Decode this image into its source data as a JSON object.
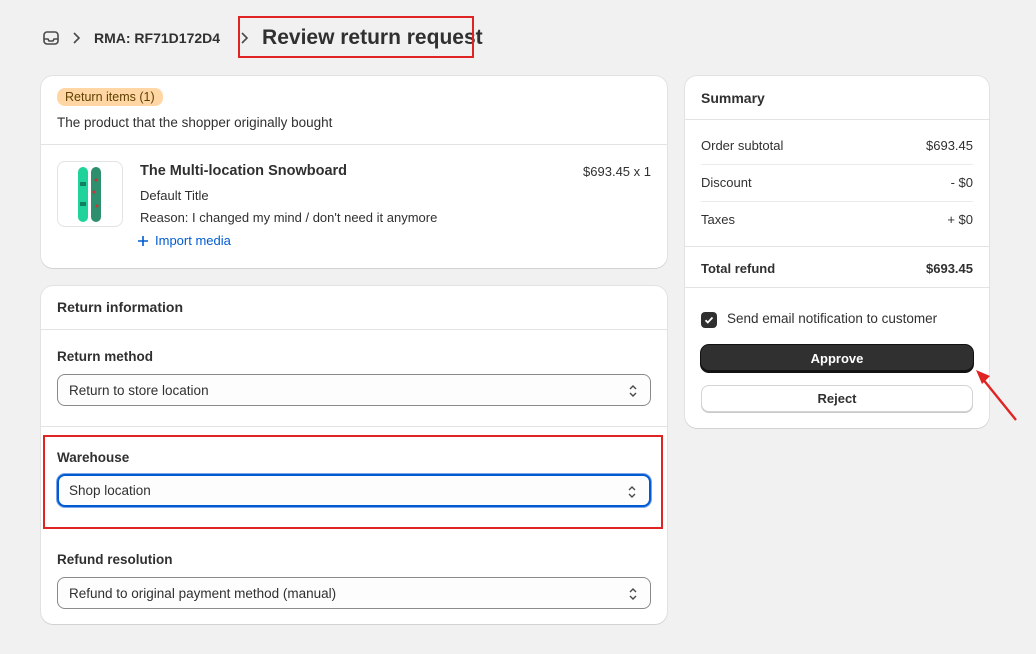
{
  "breadcrumb": {
    "icon": "inbox-icon",
    "rma": "RMA: RF71D172D4",
    "title": "Review return request"
  },
  "return_items": {
    "badge": "Return items (1)",
    "subtitle": "The product that the shopper originally bought",
    "items": [
      {
        "name": "The Multi-location Snowboard",
        "variant": "Default Title",
        "reason": "Reason: I changed my mind / don't need it anymore",
        "import_media": "Import media",
        "price_qty": "$693.45 x 1"
      }
    ]
  },
  "return_info": {
    "title": "Return information",
    "return_method": {
      "label": "Return to store location",
      "field_label": "Return method"
    },
    "warehouse": {
      "field_label": "Warehouse",
      "value": "Shop location"
    },
    "refund_resolution": {
      "field_label": "Refund resolution",
      "value": "Refund to original payment method (manual)"
    }
  },
  "summary": {
    "title": "Summary",
    "rows": [
      {
        "label": "Order subtotal",
        "value": "$693.45"
      },
      {
        "label": "Discount",
        "value": "- $0"
      },
      {
        "label": "Taxes",
        "value": "+ $0"
      }
    ],
    "total": {
      "label": "Total refund",
      "value": "$693.45"
    },
    "notify_label": "Send email notification to customer",
    "notify_checked": true,
    "approve_label": "Approve",
    "reject_label": "Reject"
  },
  "colors": {
    "badge_bg": "#ffd6a4",
    "link": "#005bd3",
    "focus": "#005bd3",
    "highlight": "#e02424",
    "primary_button": "#303030"
  }
}
